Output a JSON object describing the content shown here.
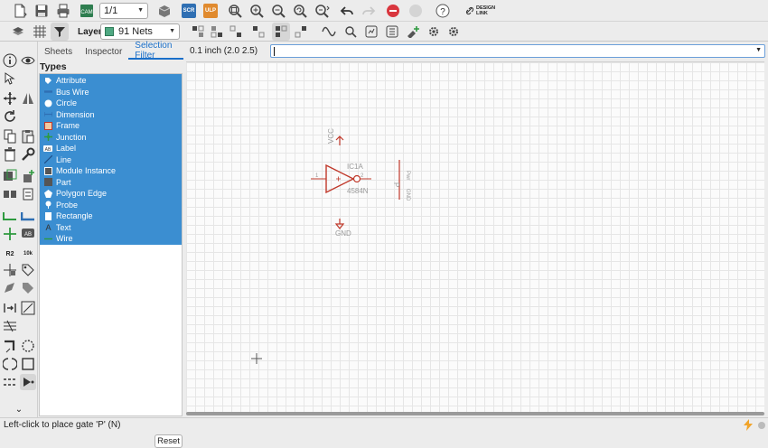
{
  "toolbar": {
    "sheet_value": "1/1",
    "scr_label": "SCR",
    "ulp_label": "ULP",
    "design_link_label": "DESIGN LINK"
  },
  "toolbar2": {
    "layer_label": "Layer:",
    "layer_value": "91 Nets",
    "layer_color": "#4fa882"
  },
  "panel": {
    "tabs": [
      "Sheets",
      "Inspector",
      "Selection Filter"
    ],
    "active_tab": "Selection Filter",
    "types_title": "Types",
    "items": [
      {
        "label": "Attribute",
        "icon": "tag-icon"
      },
      {
        "label": "Bus Wire",
        "icon": "bus-wire-icon"
      },
      {
        "label": "Circle",
        "icon": "circle-icon"
      },
      {
        "label": "Dimension",
        "icon": "dimension-icon"
      },
      {
        "label": "Frame",
        "icon": "frame-icon"
      },
      {
        "label": "Junction",
        "icon": "junction-icon"
      },
      {
        "label": "Label",
        "icon": "label-icon"
      },
      {
        "label": "Line",
        "icon": "line-icon"
      },
      {
        "label": "Module Instance",
        "icon": "module-icon"
      },
      {
        "label": "Part",
        "icon": "part-icon"
      },
      {
        "label": "Polygon Edge",
        "icon": "polygon-icon"
      },
      {
        "label": "Probe",
        "icon": "probe-icon"
      },
      {
        "label": "Rectangle",
        "icon": "rectangle-icon"
      },
      {
        "label": "Text",
        "icon": "text-icon"
      },
      {
        "label": "Wire",
        "icon": "wire-icon"
      }
    ],
    "reset_label": "Reset",
    "selection_color": "#3b8ed1"
  },
  "canvas": {
    "coordinate": "0.1 inch (2.0 2.5)",
    "command_value": "",
    "schematic": {
      "vcc_label": "VCC",
      "part_name": "IC1A",
      "part_value": "4584N",
      "gnd_label": "GND",
      "pin_in": "1",
      "pin_out": "2",
      "side_label_1": "Pwr",
      "side_label_2": "P",
      "side_label_3": "GND",
      "symbol_color": "#c0392b"
    }
  },
  "status": {
    "text": "Left-click to place gate 'P' (N)",
    "accent_color": "#f1a42a"
  }
}
